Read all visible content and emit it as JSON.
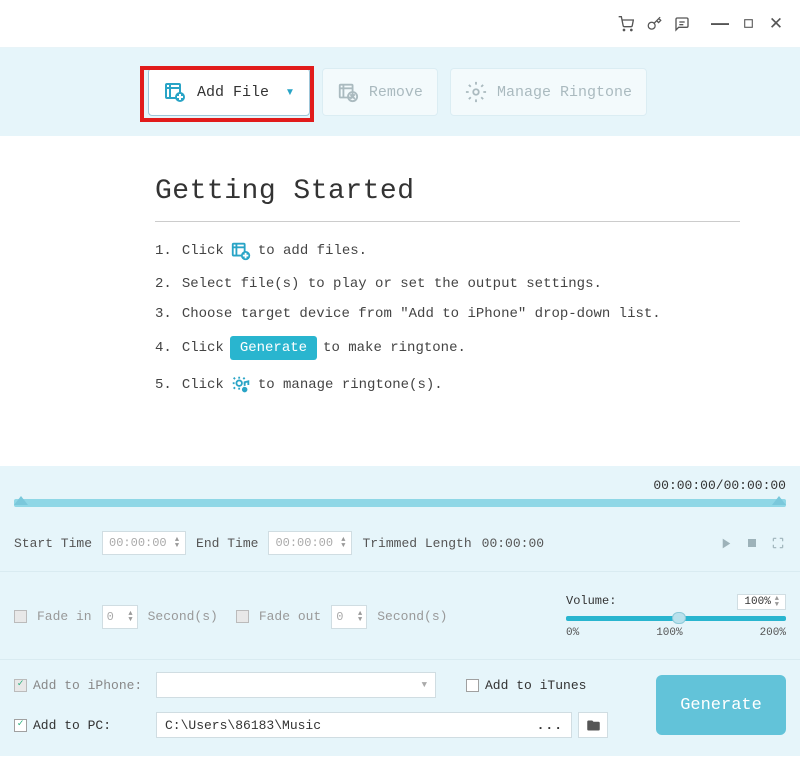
{
  "toolbar": {
    "add_file": "Add File",
    "remove": "Remove",
    "manage": "Manage Ringtone"
  },
  "getting_started": {
    "title": "Getting Started",
    "step1_a": "Click",
    "step1_b": "to add files.",
    "step2": "Select file(s) to play or set the output settings.",
    "step3": "Choose target device from \"Add to iPhone\" drop-down list.",
    "step4_a": "Click",
    "step4_btn": "Generate",
    "step4_b": "to make ringtone.",
    "step5_a": "Click",
    "step5_b": "to manage ringtone(s)."
  },
  "timeline": {
    "position": "00:00:00",
    "duration": "00:00:00",
    "start_label": "Start Time",
    "start_value": "00:00:00",
    "end_label": "End Time",
    "end_value": "00:00:00",
    "trimmed_label": "Trimmed Length",
    "trimmed_value": "00:00:00"
  },
  "fade": {
    "in_label": "Fade in",
    "in_value": "0",
    "in_unit": "Second(s)",
    "out_label": "Fade out",
    "out_value": "0",
    "out_unit": "Second(s)"
  },
  "volume": {
    "label": "Volume:",
    "percent": "100%",
    "tick0": "0%",
    "tick100": "100%",
    "tick200": "200%"
  },
  "output": {
    "iphone_label": "Add to iPhone:",
    "iphone_value": "",
    "itunes_label": "Add to iTunes",
    "pc_label": "Add to PC:",
    "pc_path": "C:\\Users\\86183\\Music",
    "generate": "Generate"
  }
}
